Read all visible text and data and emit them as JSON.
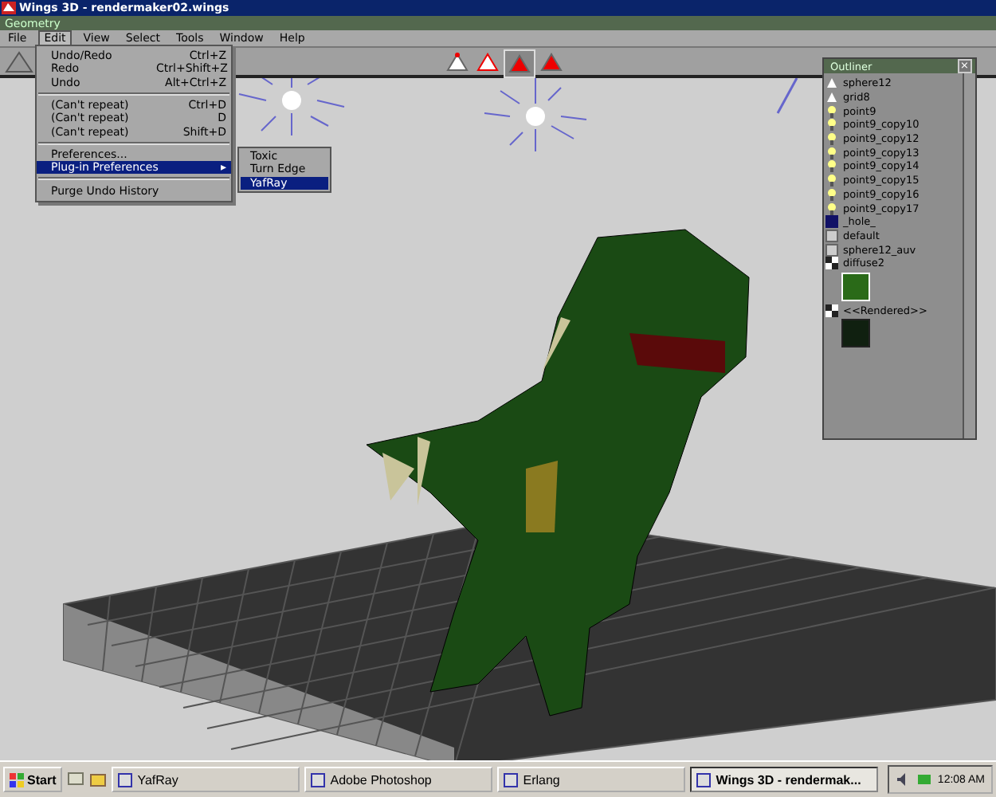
{
  "window": {
    "title": "Wings 3D - rendermaker02.wings"
  },
  "geometry_window": {
    "title": "Geometry"
  },
  "menu": [
    {
      "label": "File",
      "selected": false
    },
    {
      "label": "Edit",
      "selected": true
    },
    {
      "label": "View",
      "selected": false
    },
    {
      "label": "Select",
      "selected": false
    },
    {
      "label": "Tools",
      "selected": false
    },
    {
      "label": "Window",
      "selected": false
    },
    {
      "label": "Help",
      "selected": false
    }
  ],
  "edit_menu": {
    "items": [
      {
        "kind": "item",
        "label": "Undo/Redo",
        "shortcut": "Ctrl+Z",
        "highlighted": false
      },
      {
        "kind": "item",
        "label": "Redo",
        "shortcut": "Ctrl+Shift+Z",
        "highlighted": false
      },
      {
        "kind": "item",
        "label": "Undo",
        "shortcut": "Alt+Ctrl+Z",
        "highlighted": false
      },
      {
        "kind": "separator"
      },
      {
        "kind": "item",
        "label": "(Can't repeat)",
        "shortcut": "Ctrl+D",
        "highlighted": false
      },
      {
        "kind": "item",
        "label": "(Can't repeat)",
        "shortcut": "D",
        "highlighted": false
      },
      {
        "kind": "item",
        "label": "(Can't repeat)",
        "shortcut": "Shift+D",
        "highlighted": false
      },
      {
        "kind": "separator"
      },
      {
        "kind": "item",
        "label": "Preferences...",
        "highlighted": false
      },
      {
        "kind": "submenu",
        "label": "Plug-in Preferences",
        "arrow": "▸",
        "highlighted": true
      },
      {
        "kind": "separator"
      },
      {
        "kind": "item",
        "label": "Purge Undo History",
        "highlighted": false
      }
    ],
    "submenu": [
      {
        "label": "Toxic",
        "selected": false
      },
      {
        "label": "Turn Edge",
        "selected": false
      },
      {
        "label": "YafRay",
        "selected": true
      }
    ]
  },
  "select_modes": [
    {
      "kind": "vertex",
      "selected": false
    },
    {
      "kind": "edge",
      "selected": false
    },
    {
      "kind": "face",
      "selected": true
    },
    {
      "kind": "body",
      "selected": false
    }
  ],
  "outliner": {
    "title": "Outliner",
    "close": "×",
    "items": [
      {
        "kind": "object",
        "label": "sphere12"
      },
      {
        "kind": "object",
        "label": "grid8"
      },
      {
        "kind": "light",
        "label": "point9"
      },
      {
        "kind": "light",
        "label": "point9_copy10"
      },
      {
        "kind": "light",
        "label": "point9_copy12"
      },
      {
        "kind": "light",
        "label": "point9_copy13"
      },
      {
        "kind": "light",
        "label": "point9_copy14"
      },
      {
        "kind": "light",
        "label": "point9_copy15"
      },
      {
        "kind": "light",
        "label": "point9_copy16"
      },
      {
        "kind": "light",
        "label": "point9_copy17"
      },
      {
        "kind": "hole",
        "label": "_hole_"
      },
      {
        "kind": "material",
        "label": "default"
      },
      {
        "kind": "material",
        "label": "sphere12_auv"
      },
      {
        "kind": "texture_image",
        "label": "diffuse2"
      },
      {
        "kind": "render_image",
        "label": "<<Rendered>>"
      }
    ]
  },
  "taskbar": {
    "start": "Start",
    "tasks": [
      {
        "label": "YafRay",
        "selected": false
      },
      {
        "label": "Adobe Photoshop",
        "selected": false
      },
      {
        "label": "Erlang",
        "selected": false
      },
      {
        "label": "Wings 3D - rendermak...",
        "selected": true
      }
    ],
    "clock": "12:08 AM"
  }
}
